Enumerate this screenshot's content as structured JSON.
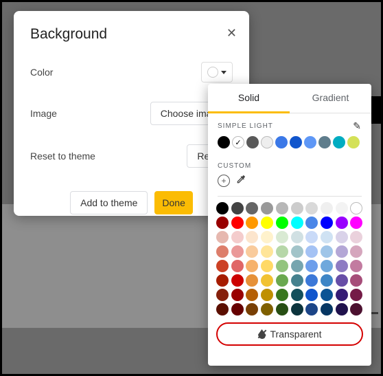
{
  "dialog": {
    "title": "Background",
    "rows": {
      "color_label": "Color",
      "image_label": "Image",
      "choose_image_btn": "Choose image",
      "reset_label": "Reset to theme",
      "reset_btn": "Reset"
    },
    "buttons": {
      "add_to_theme": "Add to theme",
      "done": "Done"
    }
  },
  "picker": {
    "tabs": {
      "solid": "Solid",
      "gradient": "Gradient"
    },
    "section_theme": "SIMPLE LIGHT",
    "section_custom": "CUSTOM",
    "transparent_label": "Transparent",
    "theme_colors": [
      {
        "hex": "#000000"
      },
      {
        "hex": "#ffffff",
        "checked": true,
        "outline": true
      },
      {
        "hex": "#595959"
      },
      {
        "hex": "#eeeeee",
        "outline": true
      },
      {
        "hex": "#3b78e7"
      },
      {
        "hex": "#1155cc"
      },
      {
        "hex": "#5e97f6"
      },
      {
        "hex": "#5f7d8c"
      },
      {
        "hex": "#00acc1"
      },
      {
        "hex": "#d4e157"
      }
    ],
    "palette": [
      "#000000",
      "#434343",
      "#666666",
      "#999999",
      "#b7b7b7",
      "#cccccc",
      "#d9d9d9",
      "#efefef",
      "#f3f3f3",
      "#ffffff",
      "#980000",
      "#ff0000",
      "#ff9900",
      "#ffff00",
      "#00ff00",
      "#00ffff",
      "#4a86e8",
      "#0000ff",
      "#9900ff",
      "#ff00ff",
      "#e6b8af",
      "#f4cccc",
      "#fce5cd",
      "#fff2cc",
      "#d9ead3",
      "#d0e0e3",
      "#c9daf8",
      "#cfe2f3",
      "#d9d2e9",
      "#ead1dc",
      "#dd7e6b",
      "#ea9999",
      "#f9cb9c",
      "#ffe599",
      "#b6d7a8",
      "#a2c4c9",
      "#a4c2f4",
      "#9fc5e8",
      "#b4a7d6",
      "#d5a6bd",
      "#cc4125",
      "#e06666",
      "#f6b26b",
      "#ffd966",
      "#93c47d",
      "#76a5af",
      "#6d9eeb",
      "#6fa8dc",
      "#8e7cc3",
      "#c27ba0",
      "#a61c00",
      "#cc0000",
      "#e69138",
      "#f1c232",
      "#6aa84f",
      "#45818e",
      "#3c78d8",
      "#3d85c6",
      "#674ea7",
      "#a64d79",
      "#85200c",
      "#990000",
      "#b45f06",
      "#bf9000",
      "#38761d",
      "#134f5c",
      "#1155cc",
      "#0b5394",
      "#351c75",
      "#741b47",
      "#5b0f00",
      "#660000",
      "#783f04",
      "#7f6000",
      "#274e13",
      "#0c343d",
      "#1c4587",
      "#073763",
      "#20124d",
      "#4c1130"
    ]
  }
}
